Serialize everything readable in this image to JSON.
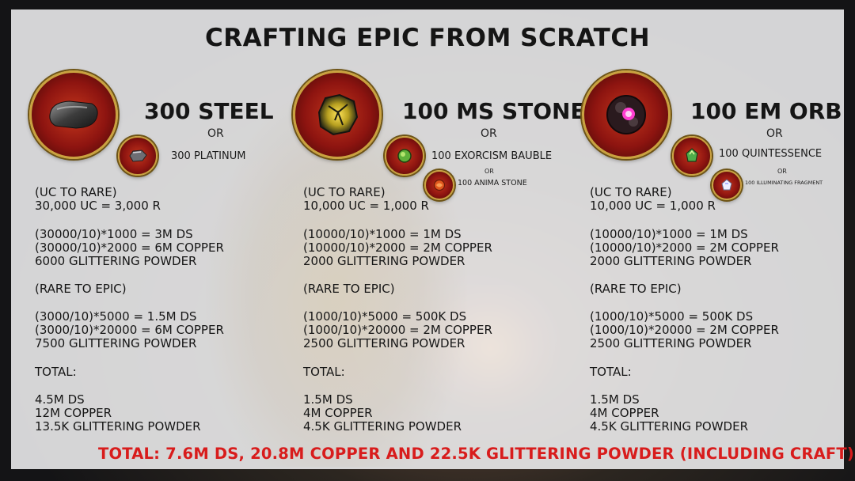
{
  "title": "CRAFTING EPIC FROM SCRATCH",
  "columns": [
    {
      "main_item": "300 STEEL",
      "or1": "OR",
      "alt_item": "300 PLATINUM",
      "lines": [
        "(UC TO RARE)",
        "30,000 UC = 3,000 R",
        "(30000/10)*1000 = 3M DS",
        "(30000/10)*2000 = 6M COPPER",
        "6000 GLITTERING POWDER",
        "(RARE TO EPIC)",
        "(3000/10)*5000 = 1.5M DS",
        "(3000/10)*20000 = 6M COPPER",
        "7500 GLITTERING POWDER",
        "TOTAL:",
        "4.5M DS",
        "12M COPPER",
        "13.5K GLITTERING POWDER"
      ]
    },
    {
      "main_item": "100 MS STONE",
      "or1": "OR",
      "alt_item": "100 EXORCISM BAUBLE",
      "or2": "OR",
      "alt_item2": "100 ANIMA STONE",
      "lines": [
        "(UC TO RARE)",
        "10,000 UC = 1,000 R",
        "(10000/10)*1000 = 1M DS",
        "(10000/10)*2000 = 2M COPPER",
        "2000 GLITTERING POWDER",
        "(RARE TO EPIC)",
        "(1000/10)*5000 = 500K DS",
        "(1000/10)*20000 = 2M COPPER",
        "2500 GLITTERING POWDER",
        "TOTAL:",
        "1.5M DS",
        "4M COPPER",
        "4.5K GLITTERING POWDER"
      ]
    },
    {
      "main_item": "100 EM ORB",
      "or1": "OR",
      "alt_item": "100 QUINTESSENCE",
      "or2": "OR",
      "alt_item2": "100 ILLUMINATING FRAGMENT",
      "lines": [
        "(UC TO RARE)",
        "10,000 UC = 1,000 R",
        "(10000/10)*1000 = 1M DS",
        "(10000/10)*2000 = 2M COPPER",
        "2000 GLITTERING POWDER",
        "(RARE TO EPIC)",
        "(1000/10)*5000 = 500K DS",
        "(1000/10)*20000 = 2M COPPER",
        "2500 GLITTERING POWDER",
        "TOTAL:",
        "1.5M DS",
        "4M COPPER",
        "4.5K GLITTERING POWDER"
      ]
    }
  ],
  "grand_total": "TOTAL: 7.6M DS, 20.8M COPPER AND 22.5K GLITTERING POWDER (INCLUDING CRAFT)",
  "colors": {
    "total": "#d81c1c",
    "orb_ring": "#caa240",
    "orb_fill": "#a8200f"
  },
  "icons": [
    "steel-icon",
    "platinum-icon",
    "ms-stone-icon",
    "exorcism-bauble-icon",
    "anima-stone-icon",
    "em-orb-icon",
    "quintessence-icon",
    "illuminating-fragment-icon"
  ]
}
